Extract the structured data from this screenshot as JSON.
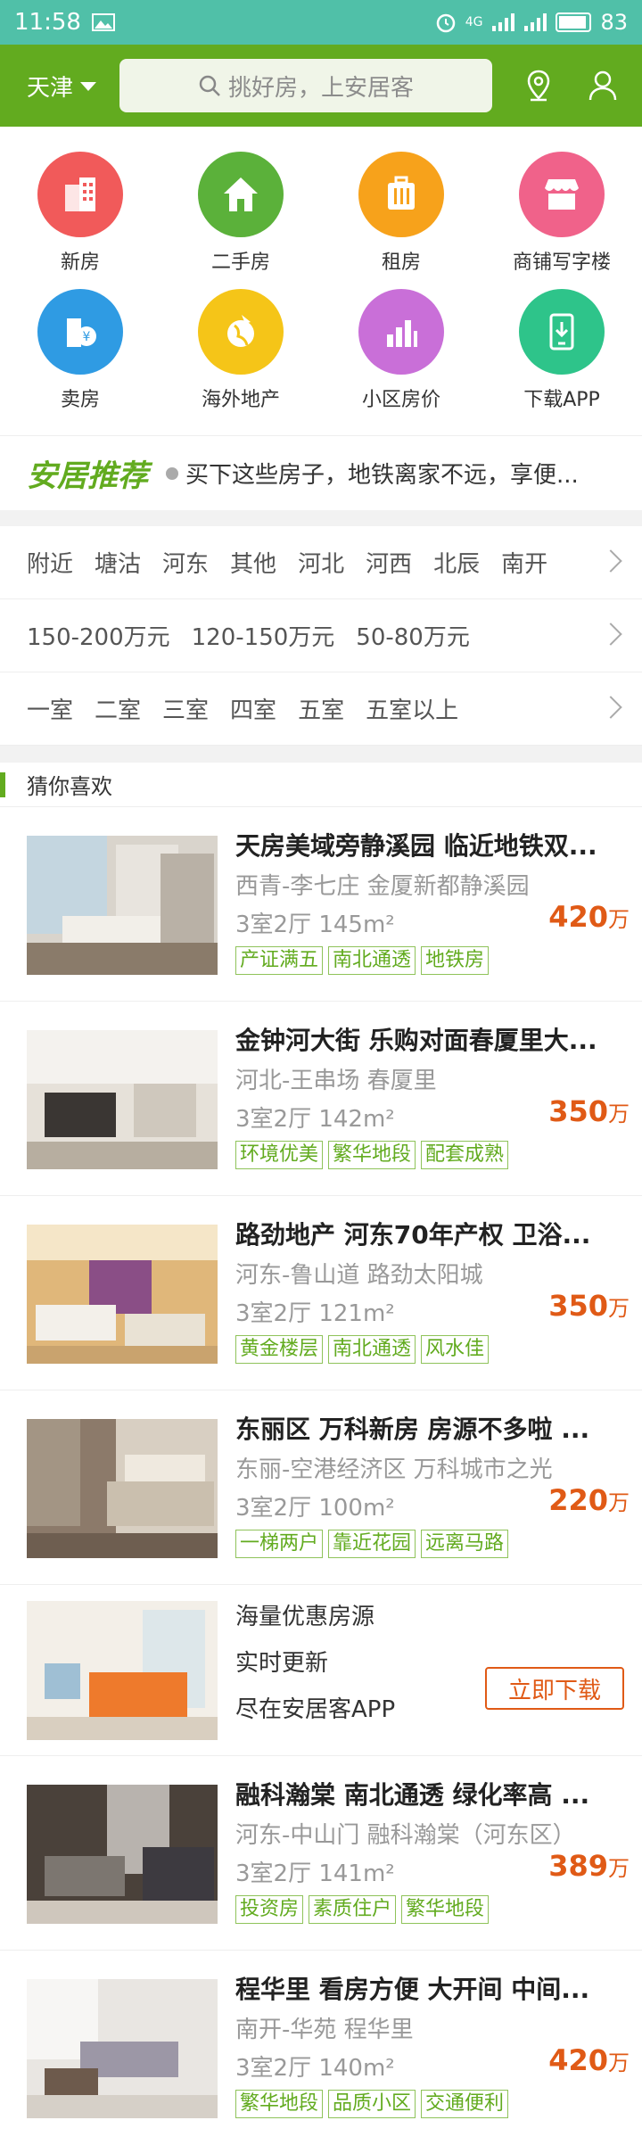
{
  "status_bar": {
    "time": "11:58",
    "network": "4G",
    "battery": "83"
  },
  "header": {
    "city": "天津",
    "search_placeholder": "挑好房，上安居客"
  },
  "categories": [
    {
      "label": "新房",
      "icon": "building-icon",
      "color": "#f15a5a"
    },
    {
      "label": "二手房",
      "icon": "house-icon",
      "color": "#5bb13a"
    },
    {
      "label": "租房",
      "icon": "luggage-icon",
      "color": "#f7a21b"
    },
    {
      "label": "商铺写字楼",
      "icon": "shop-icon",
      "color": "#f0628a"
    },
    {
      "label": "卖房",
      "icon": "sell-house-icon",
      "color": "#2f9be3"
    },
    {
      "label": "海外地产",
      "icon": "globe-icon",
      "color": "#f5c518"
    },
    {
      "label": "小区房价",
      "icon": "bar-chart-icon",
      "color": "#c96fd8"
    },
    {
      "label": "下载APP",
      "icon": "phone-download-icon",
      "color": "#2ec48a"
    }
  ],
  "recommend": {
    "logo": "安居推荐",
    "text": "买下这些房子，地铁离家不远，享便..."
  },
  "filters": {
    "areas": [
      "附近",
      "塘沽",
      "河东",
      "其他",
      "河北",
      "河西",
      "北辰",
      "南开"
    ],
    "prices": [
      "150-200万元",
      "120-150万元",
      "50-80万元"
    ],
    "rooms": [
      "一室",
      "二室",
      "三室",
      "四室",
      "五室",
      "五室以上"
    ]
  },
  "section_title": "猜你喜欢",
  "price_unit": "万",
  "listings": [
    {
      "title": "天房美域旁静溪园 临近地铁双...",
      "location": "西青-李七庄 金厦新都静溪园",
      "spec": "3室2厅 145m²",
      "price": "420",
      "tags": [
        "产证满五",
        "南北通透",
        "地铁房"
      ]
    },
    {
      "title": "金钟河大街 乐购对面春厦里大...",
      "location": "河北-王串场 春厦里",
      "spec": "3室2厅 142m²",
      "price": "350",
      "tags": [
        "环境优美",
        "繁华地段",
        "配套成熟"
      ]
    },
    {
      "title": "路劲地产 河东70年产权 卫浴...",
      "location": "河东-鲁山道 路劲太阳城",
      "spec": "3室2厅 121m²",
      "price": "350",
      "tags": [
        "黄金楼层",
        "南北通透",
        "风水佳"
      ]
    },
    {
      "title": "东丽区 万科新房 房源不多啦 ...",
      "location": "东丽-空港经济区 万科城市之光",
      "spec": "3室2厅 100m²",
      "price": "220",
      "tags": [
        "一梯两户",
        "靠近花园",
        "远离马路"
      ]
    }
  ],
  "promo": {
    "line1": "海量优惠房源",
    "line2": "实时更新",
    "line3": "尽在安居客APP",
    "button": "立即下载"
  },
  "listings2": [
    {
      "title": "融科瀚棠 南北通透 绿化率高 ...",
      "location": "河东-中山门 融科瀚棠（河东区）",
      "spec": "3室2厅 141m²",
      "price": "389",
      "tags": [
        "投资房",
        "素质住户",
        "繁华地段"
      ]
    },
    {
      "title": "程华里 看房方便 大开间 中间...",
      "location": "南开-华苑 程华里",
      "spec": "3室2厅 140m²",
      "price": "420",
      "tags": [
        "繁华地段",
        "品质小区",
        "交通便利"
      ]
    }
  ]
}
